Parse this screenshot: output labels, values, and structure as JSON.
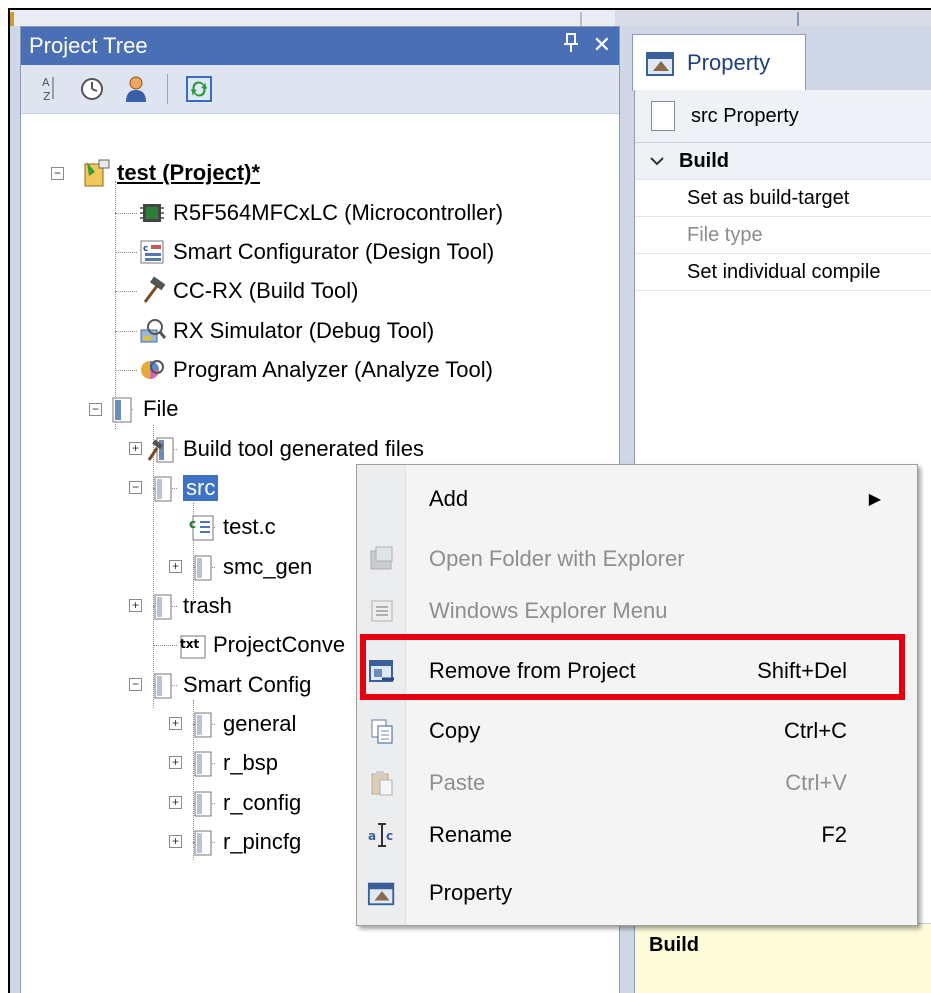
{
  "tree_panel": {
    "title": "Project Tree",
    "pin_glyph": "ᵖ",
    "close_glyph": "✕",
    "toolbar_icons": [
      "sort-az-icon",
      "clock-icon",
      "user-icon",
      "refresh-icon"
    ],
    "nodes": {
      "project": "test (Project)*",
      "mcu": "R5F564MFCxLC (Microcontroller)",
      "smartcfg": "Smart Configurator (Design Tool)",
      "ccrx": "CC-RX (Build Tool)",
      "sim": "RX Simulator (Debug Tool)",
      "analyzer": "Program Analyzer (Analyze Tool)",
      "file": "File",
      "buildgen": "Build tool generated files",
      "src": "src",
      "testc": "test.c",
      "smcgen": "smc_gen",
      "trash": "trash",
      "projconv": "ProjectConve",
      "smartfolder": "Smart Config",
      "general": "general",
      "rbsp": "r_bsp",
      "rconfig": "r_config",
      "rpincfg": "r_pincfg"
    }
  },
  "property_panel": {
    "tab": "Property",
    "header": "src Property",
    "category": "Build",
    "rows": [
      "Set as build-target",
      "File type",
      "Set individual compile"
    ],
    "description": "Build"
  },
  "context_menu": {
    "items": [
      {
        "label": "Add",
        "shortcut": "",
        "disabled": false
      },
      {
        "label": "Open Folder with Explorer",
        "shortcut": "",
        "disabled": true
      },
      {
        "label": "Windows Explorer Menu",
        "shortcut": "",
        "disabled": true
      },
      {
        "label": "Remove from Project",
        "shortcut": "Shift+Del",
        "disabled": false
      },
      {
        "label": "Copy",
        "shortcut": "Ctrl+C",
        "disabled": false
      },
      {
        "label": "Paste",
        "shortcut": "Ctrl+V",
        "disabled": true
      },
      {
        "label": "Rename",
        "shortcut": "F2",
        "disabled": false
      },
      {
        "label": "Property",
        "shortcut": "",
        "disabled": false
      }
    ]
  },
  "colors": {
    "title_bar": "#4a6fb5",
    "selection": "#3d72c4",
    "highlight_box": "#e60012"
  }
}
